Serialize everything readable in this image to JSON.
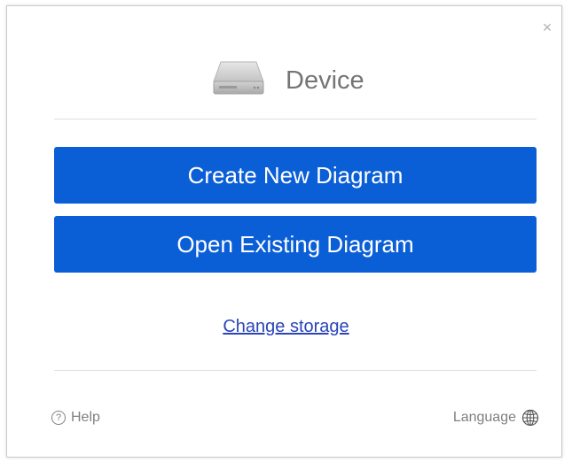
{
  "dialog": {
    "close_glyph": "×",
    "title": "Device",
    "icon": "hard-drive-icon"
  },
  "actions": {
    "create_label": "Create New Diagram",
    "open_label": "Open Existing Diagram",
    "change_storage_label": "Change storage"
  },
  "footer": {
    "help_glyph": "?",
    "help_label": "Help",
    "language_label": "Language",
    "language_icon": "globe-icon"
  },
  "colors": {
    "primary_button": "#0b5fd6",
    "link": "#2a45b8",
    "muted_text": "#808080",
    "title_text": "#757575"
  }
}
